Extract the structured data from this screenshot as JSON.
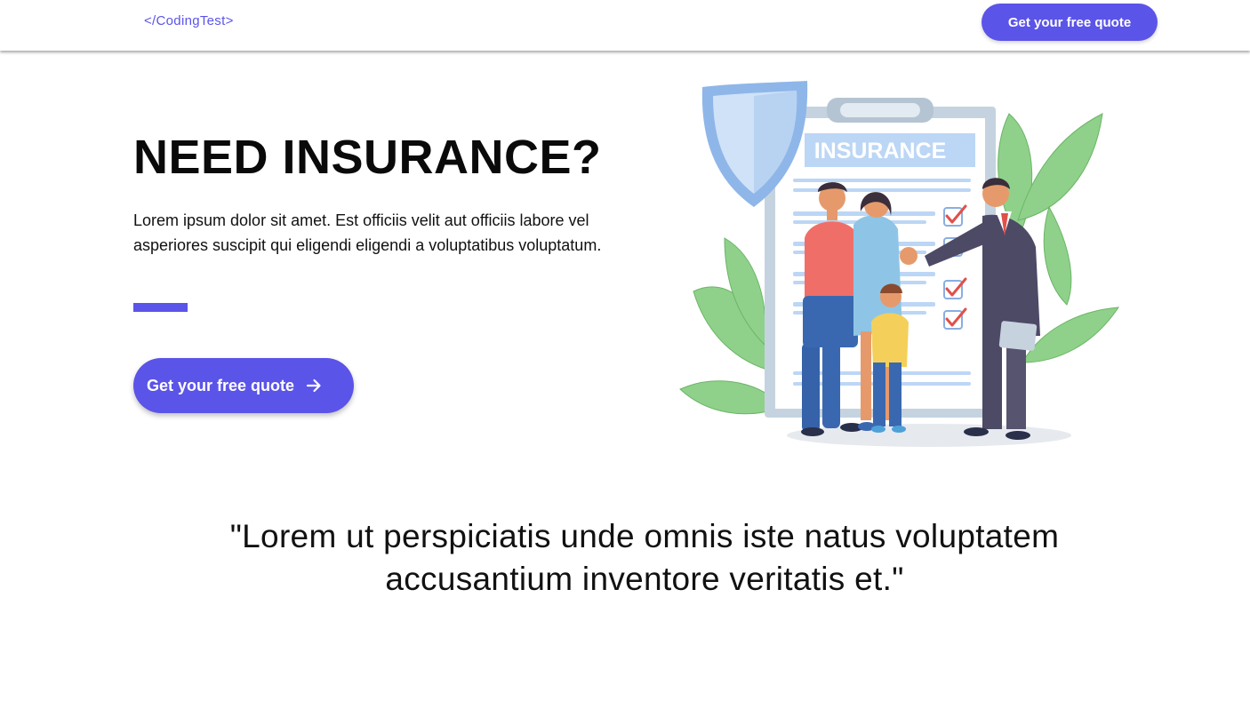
{
  "nav": {
    "logo": "</CodingTest>",
    "cta_label": "Get your free quote"
  },
  "hero": {
    "title": "NEED INSURANCE?",
    "description": "Lorem ipsum dolor sit amet. Est officiis velit aut officiis labore vel asperiores suscipit qui eligendi eligendi a voluptatibus voluptatum.",
    "cta_label": "Get your free quote",
    "cta_icon": "arrow-right-icon"
  },
  "illustration": {
    "sign_text": "INSURANCE",
    "icons": [
      "shield-icon",
      "checkmark-icon"
    ]
  },
  "quote": {
    "text": "\"Lorem ut perspiciatis unde omnis iste natus voluptatem accusantium inventore veritatis et.\""
  },
  "colors": {
    "accent": "#5b54e8",
    "text": "#111111",
    "background": "#ffffff"
  }
}
